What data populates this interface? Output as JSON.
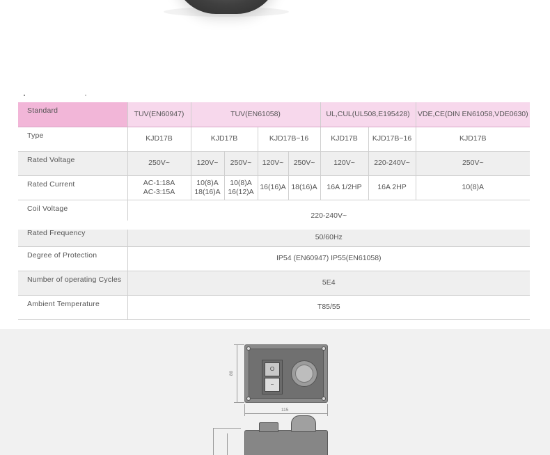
{
  "table": {
    "header": {
      "label": "Standard",
      "groups": [
        "TUV(EN60947)",
        "TUV(EN61058)",
        "UL,CUL(UL508,E195428)",
        "VDE,CE(DIN EN61058,VDE0630)"
      ]
    },
    "type_row": {
      "label": "Type",
      "values": [
        "KJD17B",
        "KJD17B",
        "KJD17B−16",
        "KJD17B",
        "KJD17B−16",
        "KJD17B"
      ]
    },
    "voltage_row": {
      "label": "Rated Voltage",
      "values": [
        "250V~",
        "120V~",
        "250V~",
        "120V~",
        "250V~",
        "120V~",
        "220-240V~",
        "250V~"
      ]
    },
    "current_row": {
      "label": "Rated Current",
      "values": [
        [
          "AC-1:18A",
          "AC-3:15A"
        ],
        [
          "10(8)A",
          "18(16)A"
        ],
        [
          "10(8)A",
          "16(12)A"
        ],
        [
          "16(16)A"
        ],
        [
          "18(16)A"
        ],
        [
          "16A  1/2HP"
        ],
        [
          "16A  2HP"
        ],
        [
          "10(8)A"
        ]
      ]
    },
    "coil_voltage": {
      "label": "Coil Voltage",
      "value": "220-240V~"
    },
    "frequency": {
      "label": "Rated Frequency",
      "value": "50/60Hz"
    },
    "protection": {
      "label": "Degree of Protection",
      "value": "IP54 (EN60947)   IP55(EN61058)"
    },
    "cycles": {
      "label": "Number of operating Cycles",
      "value": "5E4"
    },
    "ambient": {
      "label": "Ambient Temperature",
      "value": "T85/55"
    }
  },
  "drawing": {
    "width_dim": "115",
    "height_dim": "80",
    "switch_on_symbol": "O",
    "switch_off_symbol": "−"
  }
}
